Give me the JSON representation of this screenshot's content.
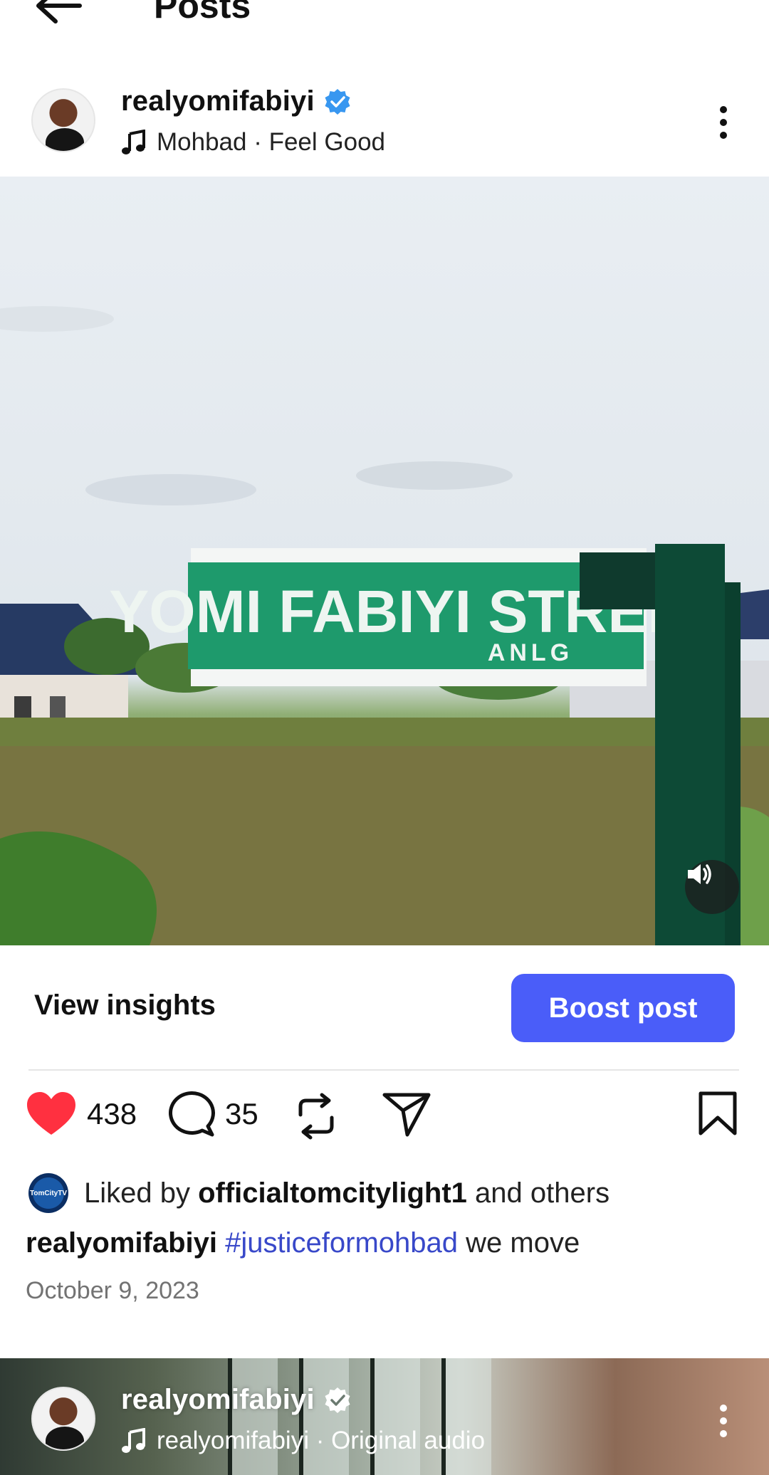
{
  "topbar": {
    "title": "Posts"
  },
  "post1": {
    "username": "realyomifabiyi",
    "audio": "Mohbad · Feel Good",
    "sign_text": "YOMI FABIYI STREET",
    "sign_subtext": "ANLG",
    "view_insights": "View insights",
    "boost_post": "Boost post",
    "likes_count": "438",
    "comments_count": "35",
    "liked_by_prefix": "Liked by",
    "liked_by_user": "officialtomcitylight1",
    "liked_by_suffix": "and others",
    "caption_user": "realyomifabiyi",
    "caption_hashtag": "#justiceformohbad",
    "caption_text": "we move",
    "date": "October 9, 2023",
    "liker_avatar_text": "TomCityTV"
  },
  "post2": {
    "username": "realyomifabiyi",
    "audio": "realyomifabiyi · Original audio"
  },
  "colors": {
    "accent": "#4a5df9",
    "like_red": "#ff3040",
    "hashtag": "#3848c9",
    "verified_blue": "#3897f0"
  },
  "icons": [
    "back-arrow-icon",
    "verified-badge-icon",
    "music-note-icon",
    "more-vertical-icon",
    "speaker-icon",
    "heart-icon",
    "comment-icon",
    "repost-icon",
    "share-icon",
    "bookmark-icon"
  ]
}
